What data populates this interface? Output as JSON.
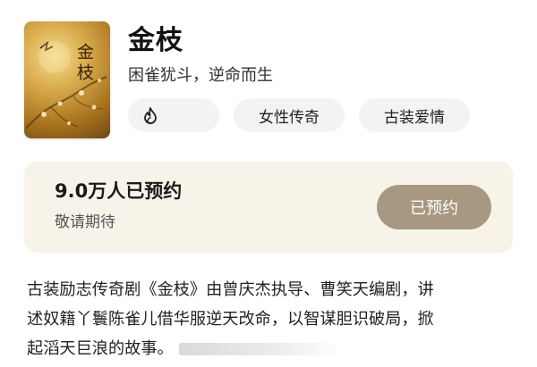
{
  "show": {
    "title": "金枝",
    "tagline": "困雀犹斗，逆命而生",
    "poster_title": "金枝",
    "tags": [
      "女性传奇",
      "古装爱情"
    ],
    "hot_icon": "flame-icon"
  },
  "reservation": {
    "count_text": "9.0万人已预约",
    "tip": "敬请期待",
    "button_label": "已预约"
  },
  "description": {
    "lines": [
      "古装励志传奇剧《金枝》由曾庆杰执导、曹笑天编剧，讲",
      "述奴籍丫鬟陈雀儿借华服逆天改命，以智谋胆识破局，掀",
      "起滔天巨浪的故事。"
    ]
  },
  "colors": {
    "card_bg": "#f8f3e9",
    "button_bg": "#a89882",
    "tag_bg": "#f3f3f3",
    "poster_gold": "#d6a84a"
  }
}
